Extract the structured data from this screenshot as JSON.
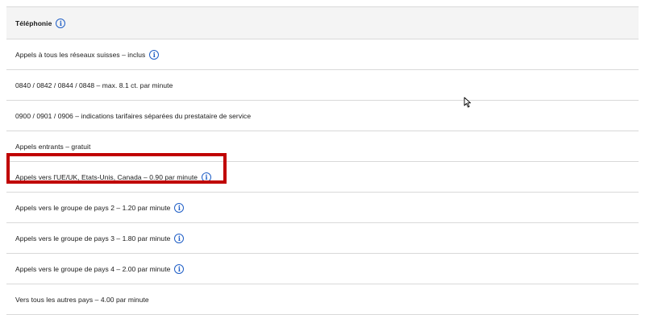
{
  "header": {
    "title": "Téléphonie"
  },
  "rows": [
    {
      "text": "Appels à tous les réseaux suisses – inclus",
      "info": true
    },
    {
      "text": "0840 / 0842 / 0844 / 0848 – max. 8.1 ct. par minute",
      "info": false
    },
    {
      "text": "0900 / 0901 / 0906 – indications tarifaires séparées du prestataire de service",
      "info": false
    },
    {
      "text": "Appels entrants – gratuit",
      "info": false
    },
    {
      "text": "Appels vers l'UE/UK, Etats-Unis, Canada – 0.90 par minute",
      "info": true
    },
    {
      "text": "Appels vers le groupe de pays 2 – 1.20 par minute",
      "info": true
    },
    {
      "text": "Appels vers le groupe de pays 3 – 1.80 par minute",
      "info": true
    },
    {
      "text": "Appels vers le groupe de pays 4 – 2.00 par minute",
      "info": true
    },
    {
      "text": "Vers tous les autres pays – 4.00 par minute",
      "info": false
    }
  ],
  "icons": {
    "info": "info-circle-icon",
    "glyph": "i"
  },
  "colors": {
    "accent": "#1f5ec6",
    "highlight": "#c00000",
    "header_bg": "#f4f4f4",
    "divider": "#d9d9d9"
  }
}
